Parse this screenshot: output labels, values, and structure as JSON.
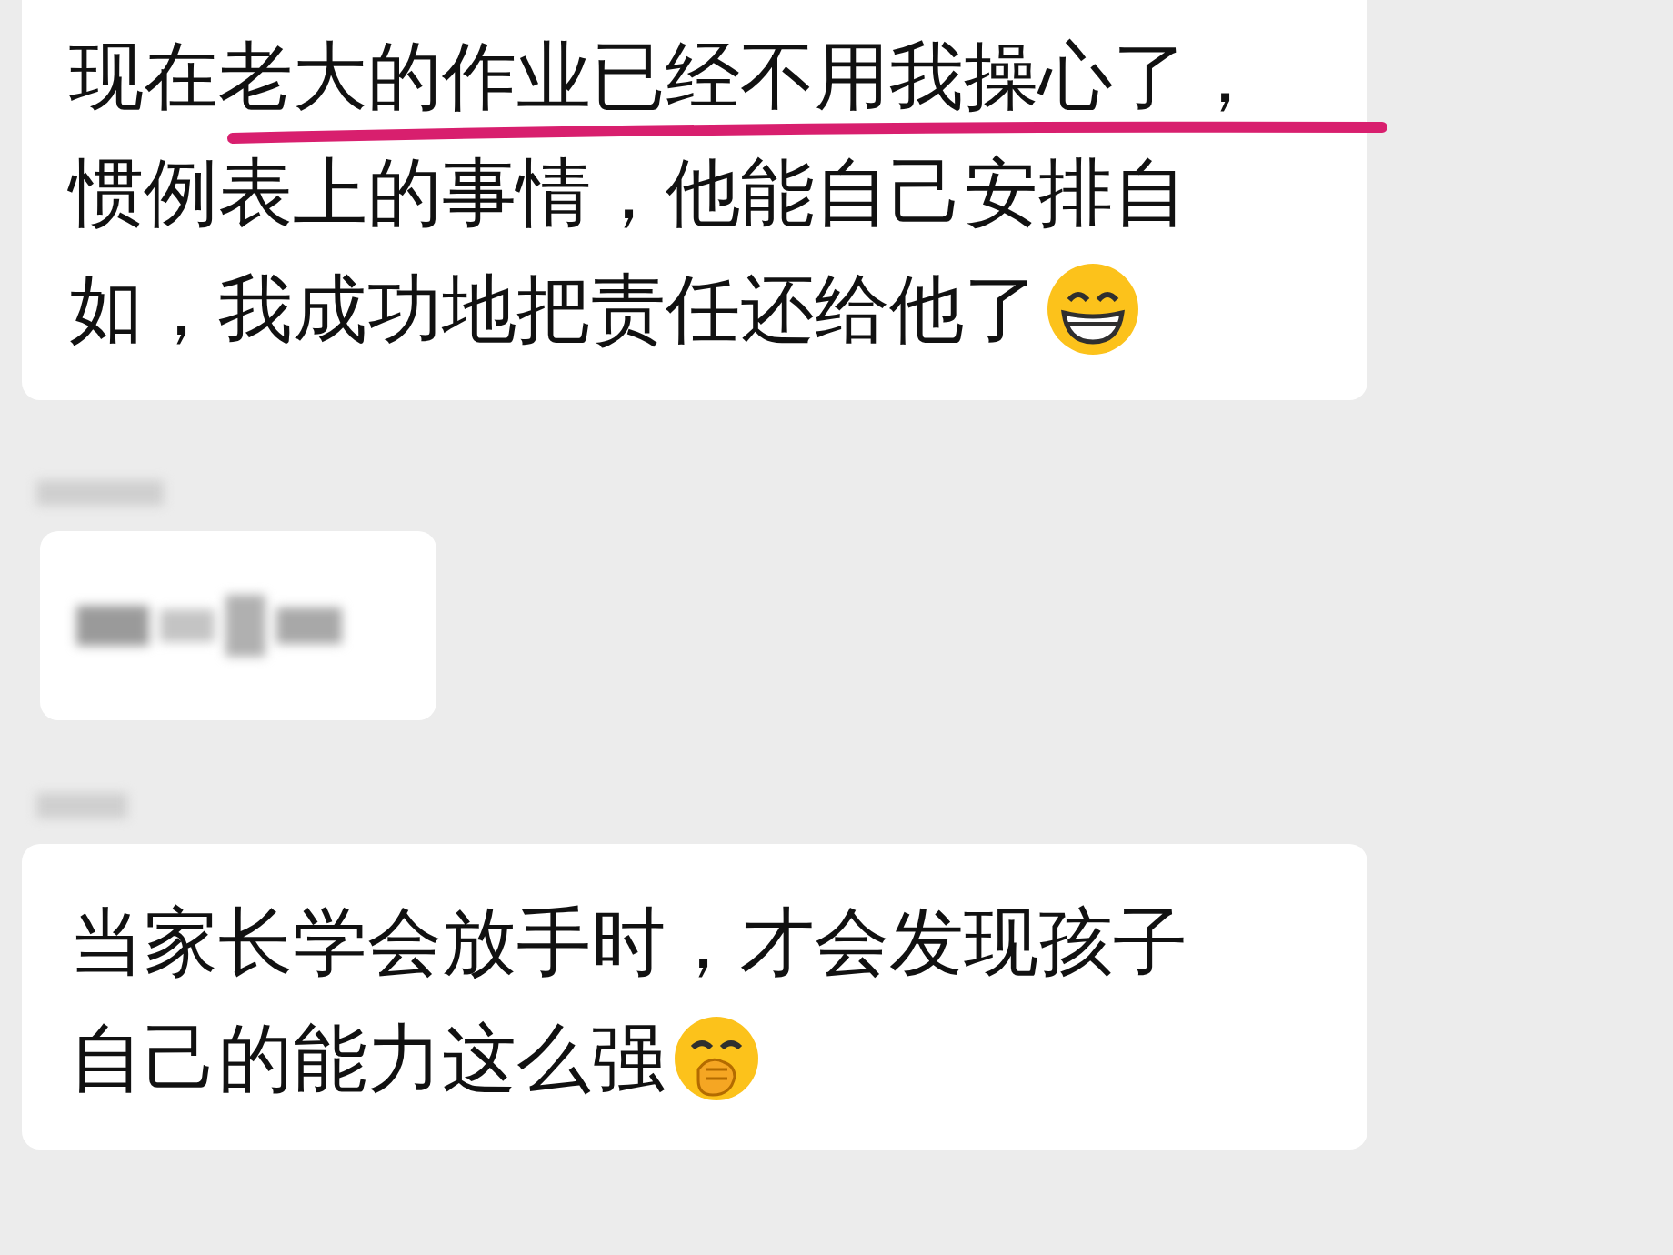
{
  "messages": [
    {
      "kind": "text",
      "lines": [
        {
          "text": "现在老大的作业已经不用我操心了，",
          "underlined": true
        },
        {
          "text": "惯例表上的事情，他能自己安排自",
          "underlined": false
        },
        {
          "text": "如，我成功地把责任还给他了",
          "underlined": false,
          "emoji_after": true
        }
      ]
    },
    {
      "kind": "blurred-name"
    },
    {
      "kind": "blurred-bubble"
    },
    {
      "kind": "blurred-name"
    },
    {
      "kind": "text",
      "lines": [
        {
          "text": "当家长学会放手时，才会发现孩子",
          "underlined": false
        },
        {
          "text": "自己的能力这么强",
          "underlined": false,
          "emoji_after": true
        }
      ]
    }
  ]
}
